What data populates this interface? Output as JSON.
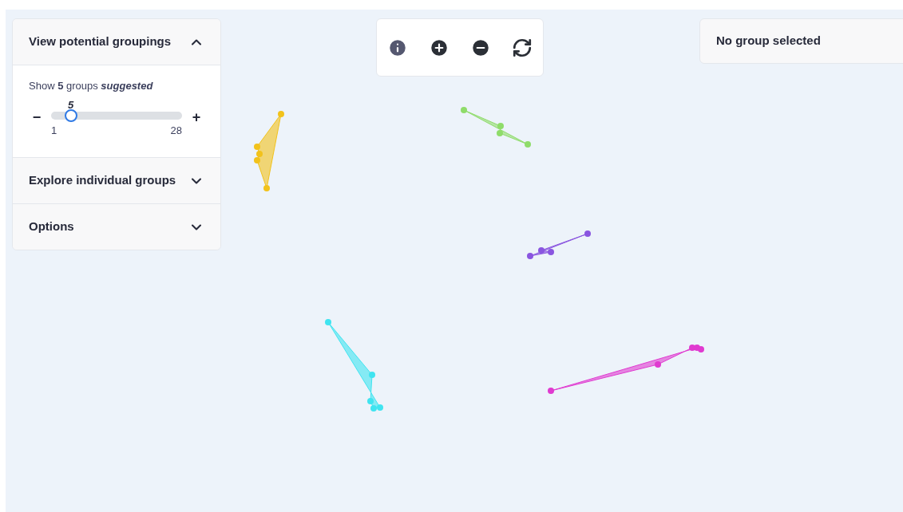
{
  "sections": [
    {
      "title": "View potential groupings",
      "expanded": true,
      "body": {
        "text": "Show **5** groups *suggested*",
        "value": "5",
        "minus": "−",
        "plus": "+",
        "min": "1",
        "max": "28",
        "level": 0.15
      }
    },
    {
      "title": "Explore individual groups",
      "expanded": false
    },
    {
      "title": "Options",
      "expanded": false
    }
  ],
  "selection": {
    "text": "No group selected"
  },
  "clusters": [
    {
      "color": "#f2c21b"
    },
    {
      "color": "#8fdc6a"
    },
    {
      "color": "#8a55e0"
    },
    {
      "color": "#40e4f0"
    },
    {
      "color": "#e03ad0"
    }
  ]
}
